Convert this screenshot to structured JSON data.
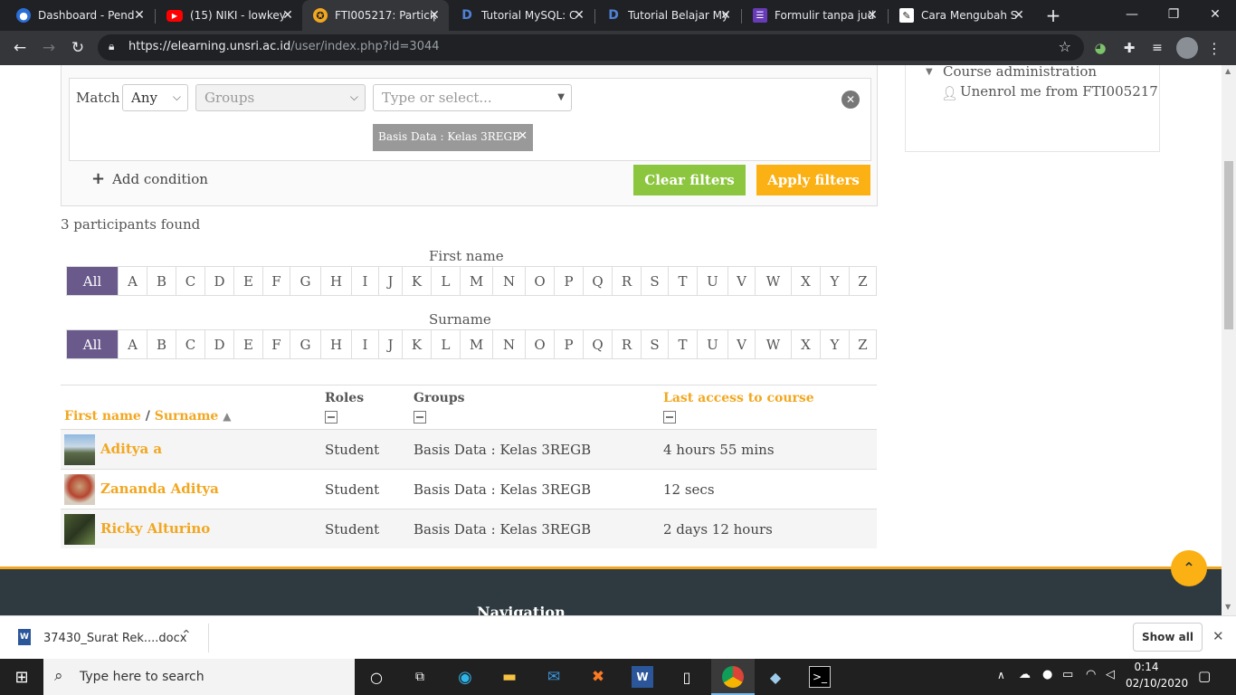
{
  "browser": {
    "tabs": [
      {
        "title": "Dashboard - Pend",
        "icon": "university-icon"
      },
      {
        "title": "(15) NIKI - lowkey",
        "icon": "youtube-icon"
      },
      {
        "title": "FTI005217: Particip",
        "icon": "moodle-icon"
      },
      {
        "title": "Tutorial MySQL: C",
        "icon": "d-icon"
      },
      {
        "title": "Tutorial Belajar My",
        "icon": "d-icon"
      },
      {
        "title": "Formulir tanpa jud",
        "icon": "forms-icon"
      },
      {
        "title": "Cara Mengubah S",
        "icon": "edit-icon"
      }
    ],
    "url_host": "https://elearning.unsri.ac.id",
    "url_path": "/user/index.php?id=3044"
  },
  "filter": {
    "match_label": "Match",
    "match_value": "Any",
    "type_value": "Groups",
    "value_placeholder": "Type or select...",
    "selected_tag": "Basis Data : Kelas 3REGB",
    "add_condition": "Add condition",
    "clear": "Clear filters",
    "apply": "Apply filters"
  },
  "sidebar": {
    "section": "Course administration",
    "item": "Unenrol me from FTI005217"
  },
  "results": {
    "count_text": "3 participants found",
    "firstname_label": "First name",
    "surname_label": "Surname",
    "letters": [
      "All",
      "A",
      "B",
      "C",
      "D",
      "E",
      "F",
      "G",
      "H",
      "I",
      "J",
      "K",
      "L",
      "M",
      "N",
      "O",
      "P",
      "Q",
      "R",
      "S",
      "T",
      "U",
      "V",
      "W",
      "X",
      "Y",
      "Z"
    ]
  },
  "table": {
    "col_firstname": "First name",
    "col_sep": "/",
    "col_surname": "Surname",
    "col_roles": "Roles",
    "col_groups": "Groups",
    "col_lastaccess": "Last access to course",
    "rows": [
      {
        "name": "Aditya a",
        "role": "Student",
        "group": "Basis Data : Kelas 3REGB",
        "access": "4 hours 55 mins"
      },
      {
        "name": "Zananda Aditya",
        "role": "Student",
        "group": "Basis Data : Kelas 3REGB",
        "access": "12 secs"
      },
      {
        "name": "Ricky Alturino",
        "role": "Student",
        "group": "Basis Data : Kelas 3REGB",
        "access": "2 days 12 hours"
      }
    ]
  },
  "footer": {
    "navigation": "Navigation"
  },
  "download": {
    "file": "37430_Surat Rek....docx",
    "show_all": "Show all"
  },
  "taskbar": {
    "search_placeholder": "Type here to search",
    "time": "0:14",
    "date": "02/10/2020"
  },
  "colors": {
    "accent": "#f2a720",
    "clear": "#8cc63f",
    "apply": "#fbb013",
    "letter_active": "#6a5a8c"
  }
}
